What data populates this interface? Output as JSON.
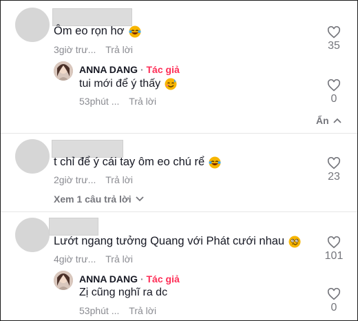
{
  "reply_label": "Trả lời",
  "author_tag": "Tác giả",
  "comments": [
    {
      "text": "Ôm eo rọn hơ",
      "emoji": "laughing-tears-icon",
      "time": "3giờ trư...",
      "likes": "35",
      "replies": [
        {
          "author": "ANNA DANG",
          "text": "tui mới để ý thấy",
          "emoji": "smiling-sweat-icon",
          "time": "53phút ...",
          "likes": "0"
        }
      ],
      "toggle_label": "Ẩn"
    },
    {
      "text": "t chỉ để ý cái tay ôm eo chú rể",
      "emoji": "laughing-tears-icon",
      "time": "2giờ trư...",
      "likes": "23",
      "toggle_label": "Xem 1 câu trả lời"
    },
    {
      "text": "Lướt ngang tưởng Quang với Phát cưới nhau",
      "emoji": "dizzy-face-icon",
      "time": "4giờ trư...",
      "likes": "101",
      "replies": [
        {
          "author": "ANNA DANG",
          "text": "Zị cũng nghĩ ra dc",
          "time": "53phút ...",
          "likes": "0"
        }
      ]
    }
  ]
}
